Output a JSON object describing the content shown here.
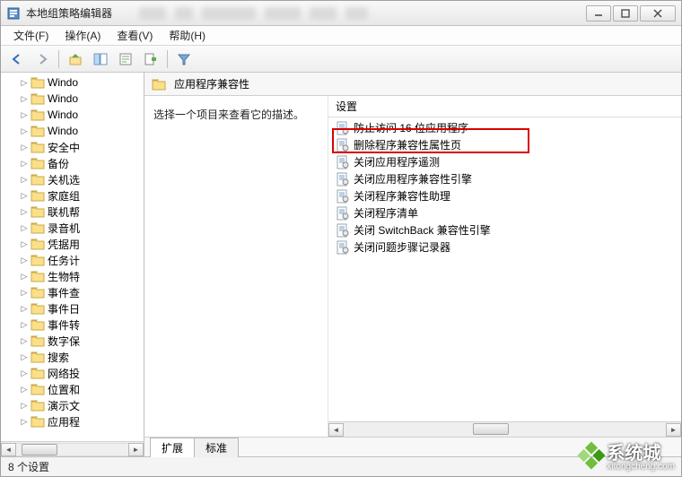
{
  "window": {
    "title": "本地组策略编辑器"
  },
  "menus": {
    "file": "文件(F)",
    "action": "操作(A)",
    "view": "查看(V)",
    "help": "帮助(H)"
  },
  "tree": {
    "items": [
      {
        "label": "Windo"
      },
      {
        "label": "Windo"
      },
      {
        "label": "Windo"
      },
      {
        "label": "Windo"
      },
      {
        "label": "安全中"
      },
      {
        "label": "备份"
      },
      {
        "label": "关机选"
      },
      {
        "label": "家庭组"
      },
      {
        "label": "联机帮"
      },
      {
        "label": "录音机"
      },
      {
        "label": "凭据用"
      },
      {
        "label": "任务计"
      },
      {
        "label": "生物特"
      },
      {
        "label": "事件查"
      },
      {
        "label": "事件日"
      },
      {
        "label": "事件转"
      },
      {
        "label": "数字保"
      },
      {
        "label": "搜索"
      },
      {
        "label": "网络投"
      },
      {
        "label": "位置和"
      },
      {
        "label": "演示文"
      },
      {
        "label": "应用程"
      }
    ]
  },
  "path": {
    "label": "应用程序兼容性"
  },
  "desc": {
    "text": "选择一个项目来查看它的描述。"
  },
  "list": {
    "header": "设置",
    "items": [
      "防止访问 16 位应用程序",
      "删除程序兼容性属性页",
      "关闭应用程序遥测",
      "关闭应用程序兼容性引擎",
      "关闭程序兼容性助理",
      "关闭程序清单",
      "关闭 SwitchBack 兼容性引擎",
      "关闭问题步骤记录器"
    ]
  },
  "tabs": {
    "extended": "扩展",
    "standard": "标准"
  },
  "status": {
    "text": "8 个设置"
  },
  "watermark": {
    "big": "系统城",
    "sub": "xitongcheng.com"
  }
}
